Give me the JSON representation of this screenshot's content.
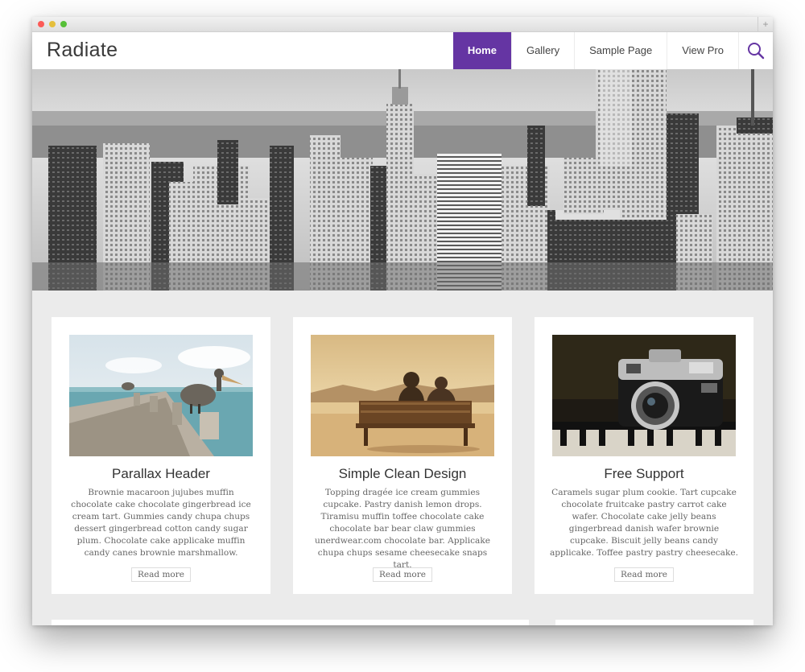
{
  "site": {
    "title": "Radiate"
  },
  "nav": {
    "items": [
      {
        "label": "Home",
        "active": true
      },
      {
        "label": "Gallery",
        "active": false
      },
      {
        "label": "Sample Page",
        "active": false
      },
      {
        "label": "View Pro",
        "active": false
      }
    ],
    "search_icon": "search-icon"
  },
  "colors": {
    "accent": "#6535a3",
    "page_bg": "#ebebeb"
  },
  "features": [
    {
      "title": "Parallax Header",
      "text": "Brownie macaroon jujubes muffin chocolate cake chocolate gingerbread ice cream tart. Gummies candy chupa chups dessert gingerbread cotton candy sugar plum. Chocolate cake applicake muffin candy canes brownie marshmallow.",
      "button": "Read more",
      "image": "pelican-on-pier"
    },
    {
      "title": "Simple Clean Design",
      "text": "Topping dragée ice cream gummies cupcake. Pastry danish lemon drops. Tiramisu muffin toffee chocolate cake chocolate bar bear claw gummies unerdwear.com chocolate bar. Applicake chupa chups sesame cheesecake snaps tart.",
      "button": "Read more",
      "image": "couple-on-bench"
    },
    {
      "title": "Free Support",
      "text": "Caramels sugar plum cookie. Tart cupcake chocolate fruitcake pastry carrot cake wafer. Chocolate cake jelly beans gingerbread danish wafer brownie cupcake. Biscuit jelly beans candy applicake. Toffee pastry pastry cheesecake.",
      "button": "Read more",
      "image": "vintage-camera"
    }
  ]
}
